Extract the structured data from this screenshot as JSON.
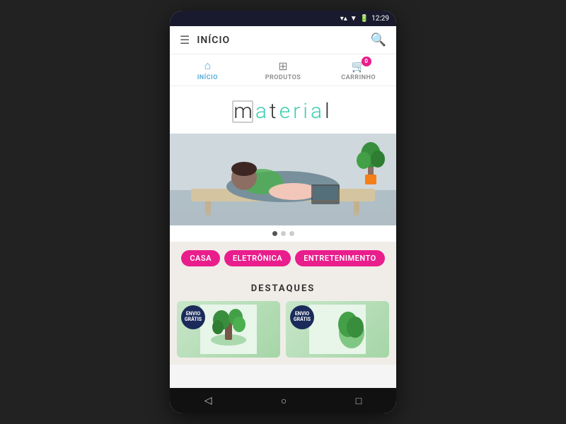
{
  "statusBar": {
    "time": "12:29",
    "icons": "▼ ▲ 📶 🔋"
  },
  "topBar": {
    "title": "INÍCIO",
    "hamburgerLabel": "☰",
    "searchLabel": "🔍"
  },
  "navTabs": [
    {
      "id": "inicio",
      "icon": "🏠",
      "label": "INÍCIO",
      "active": true
    },
    {
      "id": "produtos",
      "icon": "⊞",
      "label": "PRODUTOS",
      "active": false
    },
    {
      "id": "carrinho",
      "icon": "🛒",
      "label": "CARRINHO",
      "active": false,
      "badge": "0"
    }
  ],
  "logo": {
    "text": "material"
  },
  "carousel": {
    "dots": 3,
    "activeDot": 1
  },
  "categories": [
    {
      "label": "CASA",
      "color": "pink"
    },
    {
      "label": "ELETRÔNICA",
      "color": "pink"
    },
    {
      "label": "ENTRETENIMENTO",
      "color": "pink"
    }
  ],
  "destaques": {
    "title": "DESTAQUES",
    "badge": "ENVIO\nGRÁTIS"
  },
  "bottomNav": {
    "back": "◁",
    "home": "○",
    "recent": "□"
  }
}
